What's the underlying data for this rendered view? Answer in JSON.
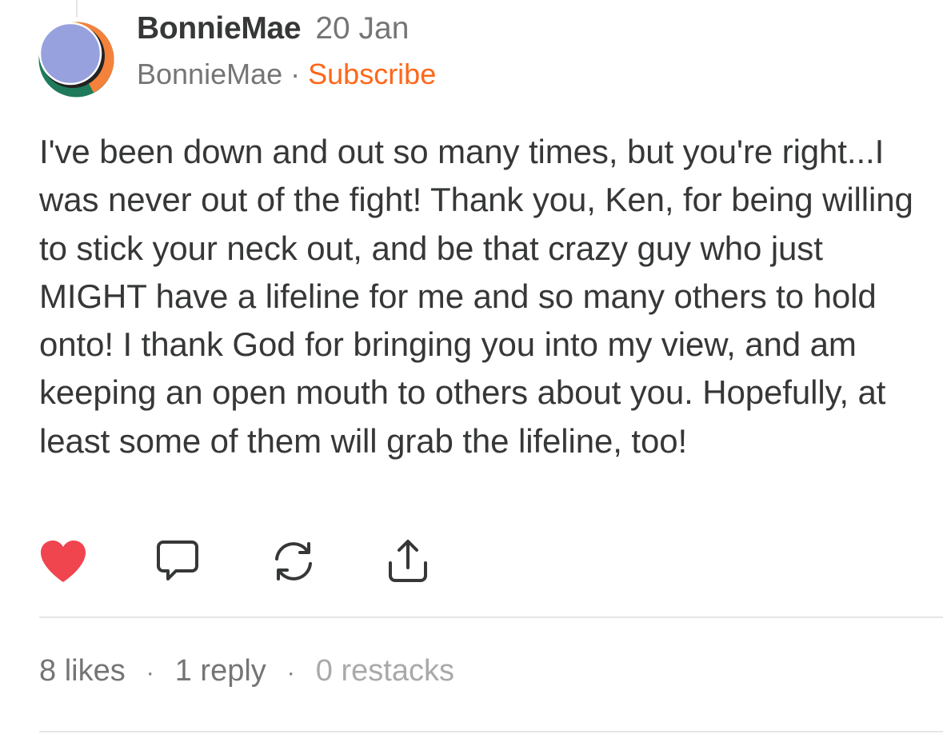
{
  "comment": {
    "author": {
      "name": "BonnieMae",
      "handle": "BonnieMae",
      "separator": "·",
      "subscribe_label": "Subscribe"
    },
    "date": "20 Jan",
    "body": "I've been down and out so many times, but you're right...I was never out of the fight! Thank you, Ken, for being willing to stick your neck out, and be that crazy guy who just MIGHT have a lifeline for me and so many others to hold onto! I thank God for bringing you into my view, and am keeping an open mouth to others about you. Hopefully, at least some of them will grab the lifeline, too!",
    "actions": [
      {
        "icon": "heart-icon",
        "state": "liked"
      },
      {
        "icon": "comment-icon"
      },
      {
        "icon": "restack-icon"
      },
      {
        "icon": "share-icon"
      }
    ],
    "stats": {
      "likes": "8 likes",
      "replies": "1 reply",
      "restacks": "0 restacks",
      "separator": "·"
    }
  },
  "colors": {
    "accent": "#ff6719",
    "like": "#f0444f",
    "text": "#363737",
    "muted": "#757575",
    "divider": "#e6e6e6",
    "avatar_fill": "#97a1de",
    "avatar_orange": "#f4823b",
    "avatar_green": "#1e7a5a",
    "avatar_yellow": "#f5c33b"
  }
}
